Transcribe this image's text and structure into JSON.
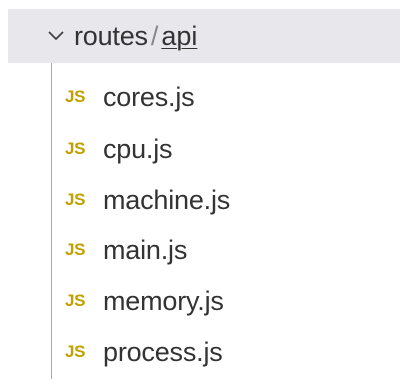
{
  "folder": {
    "name": "routes",
    "separator": "/",
    "subfolder": "api",
    "icon": "chevron-down-icon"
  },
  "files": [
    {
      "icon_text": "JS",
      "name": "cores.js"
    },
    {
      "icon_text": "JS",
      "name": "cpu.js"
    },
    {
      "icon_text": "JS",
      "name": "machine.js"
    },
    {
      "icon_text": "JS",
      "name": "main.js"
    },
    {
      "icon_text": "JS",
      "name": "memory.js"
    },
    {
      "icon_text": "JS",
      "name": "process.js"
    }
  ],
  "colors": {
    "selection_bg": "#e8e8ec",
    "js_icon": "#c2a000",
    "text": "#333333",
    "guide": "#a9a9a9"
  }
}
